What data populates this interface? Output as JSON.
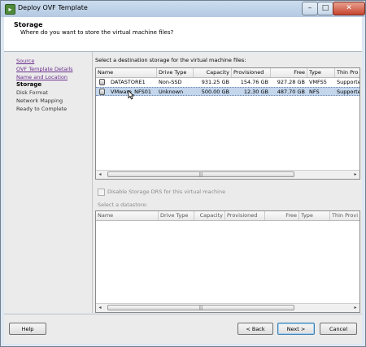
{
  "window": {
    "title": "Deploy OVF Template",
    "minimize_glyph": "–",
    "maximize_glyph": "□",
    "close_glyph": "✕"
  },
  "header": {
    "title": "Storage",
    "subtitle": "Where do you want to store the virtual machine files?"
  },
  "nav": {
    "items": [
      {
        "label": "Source",
        "state": "link"
      },
      {
        "label": "OVF Template Details",
        "state": "link"
      },
      {
        "label": "Name and Location",
        "state": "link"
      },
      {
        "label": "Storage",
        "state": "current"
      },
      {
        "label": "Disk Format",
        "state": "plain"
      },
      {
        "label": "Network Mapping",
        "state": "plain"
      },
      {
        "label": "Ready to Complete",
        "state": "plain"
      }
    ]
  },
  "main": {
    "instruction": "Select a destination storage for the virtual machine files:",
    "columns": [
      "Name",
      "Drive Type",
      "Capacity",
      "Provisioned",
      "Free",
      "Type",
      "Thin Pro"
    ],
    "rows": [
      {
        "name": "DATASTORE1",
        "drive_type": "Non-SSD",
        "capacity": "931.25 GB",
        "provisioned": "154.76 GB",
        "free": "927.28 GB",
        "type": "VMFS5",
        "thin": "Supporte",
        "selected": false
      },
      {
        "name": "VMware_NFS01",
        "drive_type": "Unknown",
        "capacity": "500.00 GB",
        "provisioned": "12.30 GB",
        "free": "487.70 GB",
        "type": "NFS",
        "thin": "Supporte",
        "selected": true
      }
    ],
    "disable_drs_label": "Disable Storage DRS for this virtual machine",
    "disable_drs_checked": false,
    "select_datastore_label": "Select a datastore:",
    "ds_columns": [
      "Name",
      "Drive Type",
      "Capacity",
      "Provisioned",
      "Free",
      "Type",
      "Thin Provi"
    ]
  },
  "footer": {
    "help_label": "Help",
    "back_label": "< Back",
    "next_label": "Next >",
    "cancel_label": "Cancel"
  },
  "scroll": {
    "left_glyph": "◂",
    "right_glyph": "▸",
    "grip_glyph": "|||"
  },
  "colors": {
    "selection": "#c3d6ec",
    "link": "#6a2d8e",
    "chrome": "#dde8f3"
  },
  "icons": [
    "app-icon",
    "datastore-icon",
    "cursor-icon"
  ]
}
